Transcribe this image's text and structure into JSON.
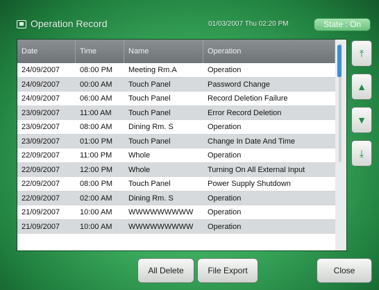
{
  "header": {
    "title": "Operation Record",
    "datetime": "01/03/2007 Thu 02:20 PM",
    "state_label": "State : On"
  },
  "table": {
    "columns": [
      "Date",
      "Time",
      "Name",
      "Operation"
    ],
    "rows": [
      [
        "24/09/2007",
        "08:00 PM",
        "Meeting Rm.A",
        "Operation"
      ],
      [
        "24/09/2007",
        "00:00 AM",
        "Touch Panel",
        "Password Change"
      ],
      [
        "24/09/2007",
        "06:00 AM",
        "Touch Panel",
        "Record Deletion Failure"
      ],
      [
        "23/09/2007",
        "11:00 AM",
        "Touch Panel",
        "Error Record Deletion"
      ],
      [
        "23/09/2007",
        "08:00 AM",
        "Dining Rm. S",
        "Operation"
      ],
      [
        "23/09/2007",
        "01:00 PM",
        "Touch Panel",
        "Change In Date And Time"
      ],
      [
        "22/09/2007",
        "11:00 PM",
        "Whole",
        "Operation"
      ],
      [
        "22/09/2007",
        "12:00 PM",
        "Whole",
        "Turning On All External Input"
      ],
      [
        "22/09/2007",
        "08:00 PM",
        "Touch Panel",
        "Power Supply Shutdown"
      ],
      [
        "22/09/2007",
        "02:00 AM",
        "Dining Rm. S",
        "Operation"
      ],
      [
        "21/09/2007",
        "10:00 AM",
        "WWWWWWWWW",
        "Operation"
      ],
      [
        "21/09/2007",
        "10:00 AM",
        "WWWWWWWWW",
        "Operation"
      ]
    ]
  },
  "scroll_buttons": {
    "top": "⤒",
    "up": "▲",
    "down": "▼",
    "bottom": "⤓"
  },
  "actions": {
    "all_delete": "All Delete",
    "file_export": "File Export",
    "close": "Close"
  },
  "colors": {
    "background": "#3aa95c",
    "header_row": "#7a7f82",
    "accent_arrow": "#1f8a3e",
    "scroll_thumb": "#3a8ed8"
  },
  "icons": [
    "screen-icon",
    "scroll-top-icon",
    "scroll-up-icon",
    "scroll-down-icon",
    "scroll-bottom-icon"
  ]
}
